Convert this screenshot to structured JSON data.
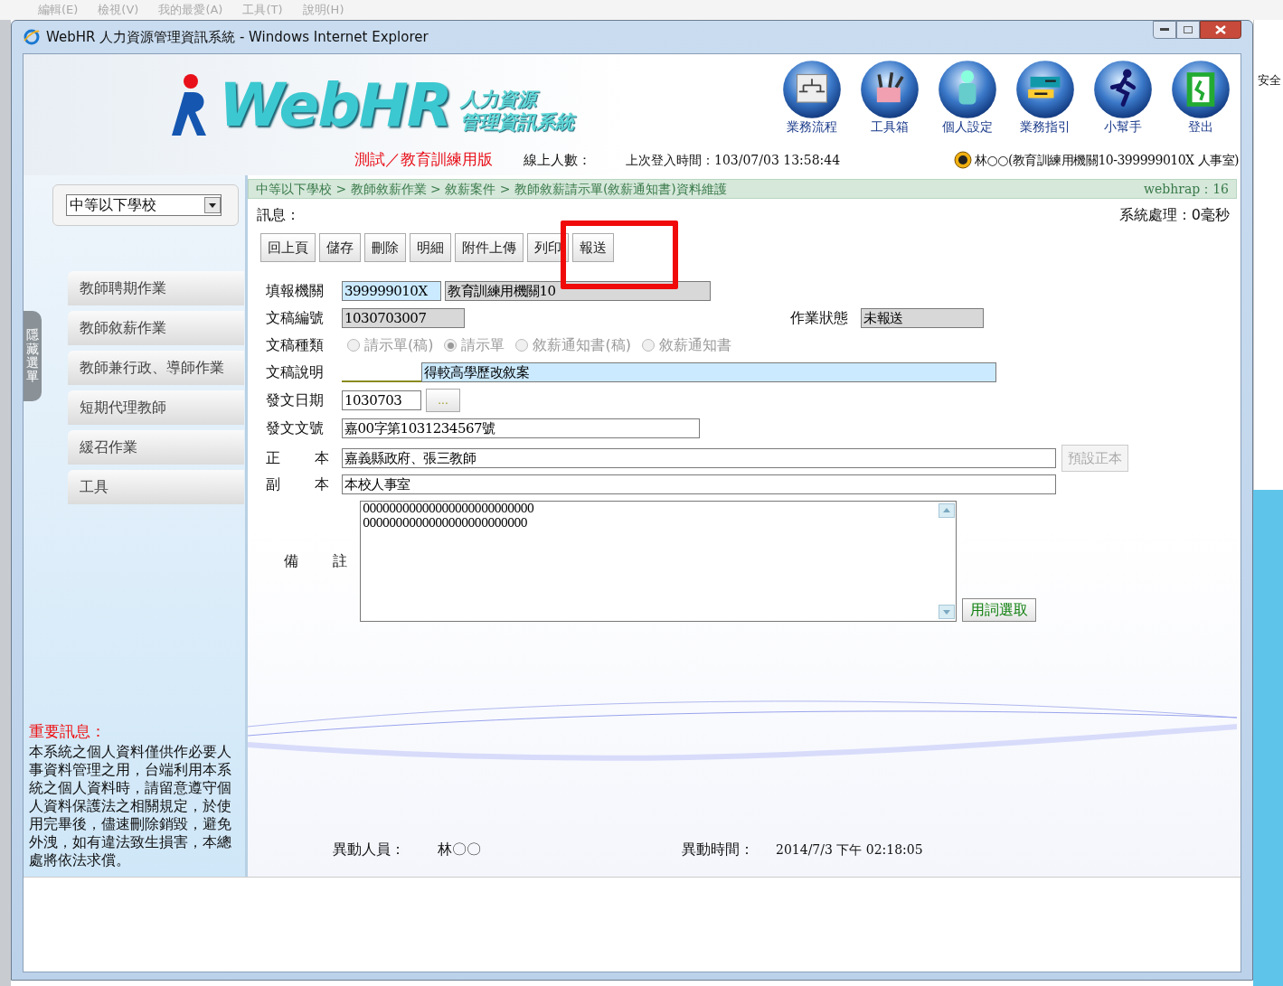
{
  "browser_menu": [
    "編輯(E)",
    "檢視(V)",
    "我的最愛(A)",
    "工具(T)",
    "說明(H)"
  ],
  "browser_side_text": "安全",
  "window": {
    "title": "WebHR 人力資源管理資訊系統 - Windows Internet Explorer"
  },
  "header": {
    "logo_text": "WebHR",
    "logo_subtitle": [
      "人力資源",
      "管理資訊系統"
    ],
    "edition": "測試／教育訓練用版",
    "online_label": "線上人數：",
    "last_login": "上次登入時間：103/07/03 13:58:44",
    "user": "林○○(教育訓練用機關10-399999010X 人事室)",
    "nav": [
      {
        "label": "業務流程",
        "kind": "flow"
      },
      {
        "label": "工具箱",
        "kind": "tools"
      },
      {
        "label": "個人設定",
        "kind": "person"
      },
      {
        "label": "業務指引",
        "kind": "signs"
      },
      {
        "label": "小幫手",
        "kind": "runner"
      },
      {
        "label": "登出",
        "kind": "exit"
      }
    ]
  },
  "sidebar": {
    "org_select": "中等以下學校",
    "hide_tab": "隱藏選單",
    "items": [
      "教師聘期作業",
      "教師敘薪作業",
      "教師兼行政、導師作業",
      "短期代理教師",
      "緩召作業",
      "工具"
    ],
    "notice_title": "重要訊息：",
    "notice_text": "本系統之個人資料僅供作必要人事資料管理之用，台端利用本系統之個人資料時，請留意遵守個人資料保護法之相關規定，於使用完畢後，儘速刪除銷毀，避免外洩，如有違法致生損害，本總處將依法求償。"
  },
  "breadcrumb": "中等以下學校 > 教師敘薪作業 > 敘薪案件 > 教師敘薪請示單(敘薪通知書)資料維護",
  "server": "webhrap：16",
  "message_label": "訊息：",
  "processing": "系統處理：0毫秒",
  "toolbar": [
    "回上頁",
    "儲存",
    "刪除",
    "明細",
    "附件上傳",
    "列印",
    "報送"
  ],
  "form": {
    "agency": {
      "label": "填報機關",
      "code": "399999010X",
      "name": "教育訓練用機關10"
    },
    "doc_no": {
      "label": "文稿編號",
      "value": "1030703007"
    },
    "status": {
      "label": "作業狀態",
      "value": "未報送"
    },
    "doc_type": {
      "label": "文稿種類",
      "disabled": true,
      "options": [
        {
          "label": "請示單(稿)",
          "selected": false
        },
        {
          "label": "請示單",
          "selected": true
        },
        {
          "label": "敘薪通知書(稿)",
          "selected": false
        },
        {
          "label": "敘薪通知書",
          "selected": false
        }
      ]
    },
    "description": {
      "label": "文稿說明",
      "value": "得較高學歷改敘案"
    },
    "issue_date": {
      "label": "發文日期",
      "value": "1030703",
      "picker": "..."
    },
    "issue_no": {
      "label": "發文文號",
      "value": "嘉00字第1031234567號"
    },
    "recipient": {
      "label_parts": [
        "正",
        "本"
      ],
      "value": "嘉義縣政府、張三教師",
      "button": "預設正本",
      "button_disabled": true
    },
    "cc": {
      "label_parts": [
        "副",
        "本"
      ],
      "value": "本校人事室"
    },
    "remarks": {
      "label_parts": [
        "備",
        "註"
      ],
      "lines": [
        "00000000000000000000000000",
        "0000000000000000000000000"
      ],
      "button": "用詞選取"
    }
  },
  "footer": {
    "modifier_label": "異動人員：",
    "modifier": "林〇〇",
    "time_label": "異動時間：",
    "time": "2014/7/3 下午 02:18:05"
  }
}
